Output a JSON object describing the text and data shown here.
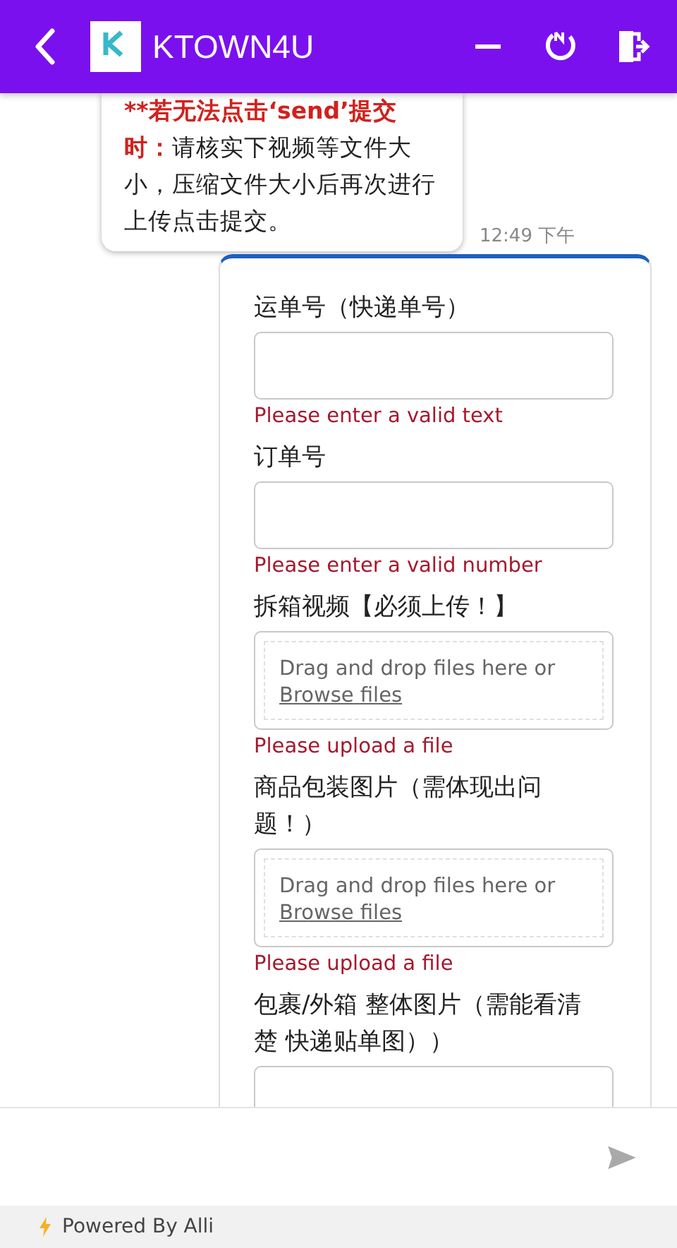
{
  "header": {
    "title": "KTOWN4U"
  },
  "message": {
    "lead": "**若无法点击‘send’提交时：",
    "body": "请核实下视频等文件大小，压缩文件大小后再次进行上传点击提交。",
    "time": "12:49 下午"
  },
  "form": {
    "fields": [
      {
        "kind": "text",
        "label": "运单号（快递单号）",
        "error": "Please enter a valid text"
      },
      {
        "kind": "text",
        "label": "订单号",
        "error": "Please enter a valid number"
      },
      {
        "kind": "upload",
        "label": "拆箱视频【必须上传！】",
        "drop_text": "Drag and drop files here or",
        "browse": "Browse files",
        "error": "Please upload a file"
      },
      {
        "kind": "upload",
        "label": "商品包装图片（需体现出问题！）",
        "drop_text": "Drag and drop files here or",
        "browse": "Browse files",
        "error": "Please upload a file"
      },
      {
        "kind": "text",
        "label": "包裹/外箱 整体图片（需能看清楚 快递贴单图））"
      }
    ]
  },
  "footer": {
    "powered": "Powered By Alli"
  }
}
